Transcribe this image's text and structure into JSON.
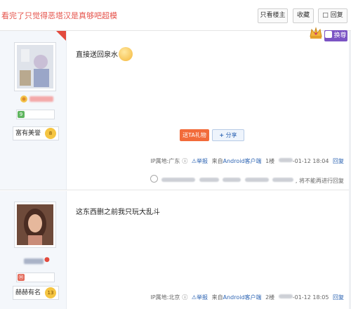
{
  "header": {
    "title": "看完了只觉得恶塔汉是真够吧超模",
    "buttons": {
      "only_op": "只看楼主",
      "favorite": "收藏",
      "reply": "回复"
    },
    "vip_label": "换尊"
  },
  "posts": [
    {
      "content": "直接送回泉水",
      "rank_label": "富有美誉",
      "rank_level": "8",
      "gift_label": "送TA礼物",
      "share_label": "分享",
      "ip": "IP属地:广东",
      "report": "举报",
      "source_prefix": "来自",
      "source_app": "Android客户端",
      "floor": "1楼",
      "date": "-01-12 18:04",
      "reply": "回复",
      "comment_suffix": ", 将不能再进行回复"
    },
    {
      "content": "这东西删之前我只玩大乱斗",
      "rank_label": "赫赫有名",
      "rank_level": "13",
      "ip": "IP属地:北京",
      "report": "举报",
      "source_prefix": "来自",
      "source_app": "Android客户端",
      "floor": "2楼",
      "date": "-01-12 18:05",
      "reply": "回复"
    }
  ],
  "colors": {
    "title": "#e5534b",
    "link": "#2d64b3",
    "gift": "#f26b3a",
    "vip": "#7b54c4"
  }
}
